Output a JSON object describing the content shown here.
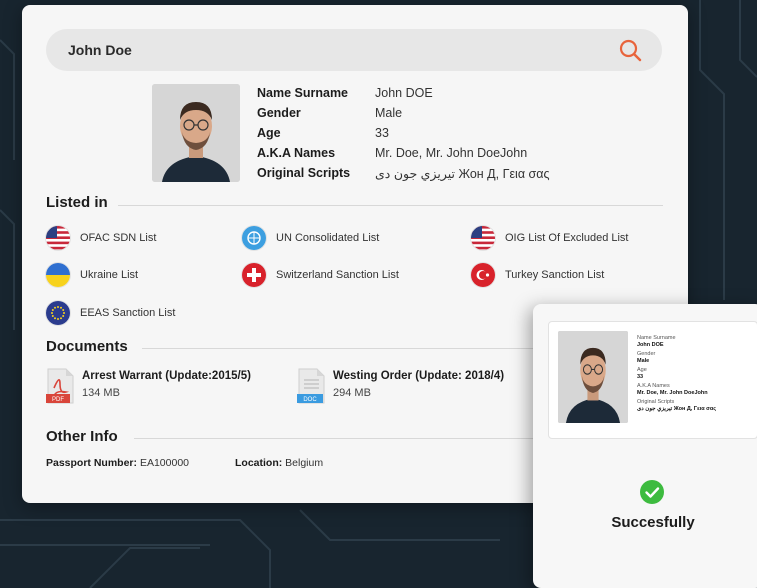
{
  "search": {
    "value": "John Doe",
    "icon": "search-icon"
  },
  "profile": {
    "fields": [
      {
        "label": "Name Surname",
        "value": "John DOE"
      },
      {
        "label": "Gender",
        "value": "Male"
      },
      {
        "label": "Age",
        "value": "33"
      },
      {
        "label": "A.K.A Names",
        "value": "Mr. Doe, Mr. John DoeJohn"
      },
      {
        "label": "Original Scripts",
        "value": "تيريزي جون دی Жон Д, Γεια σας"
      }
    ]
  },
  "listed_in": {
    "title": "Listed in",
    "items": [
      {
        "label": "OFAC SDN List",
        "icon": "usa-flag-icon"
      },
      {
        "label": "UN Consolidated List",
        "icon": "un-flag-icon"
      },
      {
        "label": "OIG List Of Excluded List",
        "icon": "usa-flag-icon"
      },
      {
        "label": "Ukraine List",
        "icon": "ukraine-flag-icon"
      },
      {
        "label": "Switzerland Sanction List",
        "icon": "switzerland-flag-icon"
      },
      {
        "label": "Turkey Sanction List",
        "icon": "turkey-flag-icon"
      },
      {
        "label": "EEAS Sanction List",
        "icon": "eu-flag-icon"
      }
    ]
  },
  "documents": {
    "title": "Documents",
    "items": [
      {
        "title": "Arrest Warrant (Update:2015/5)",
        "size": "134 MB",
        "type": "PDF"
      },
      {
        "title": "Westing Order (Update: 2018/4)",
        "size": "294 MB",
        "type": "DOC"
      }
    ]
  },
  "other_info": {
    "title": "Other Info",
    "passport_label": "Passport Number:",
    "passport_value": "EA100000",
    "location_label": "Location:",
    "location_value": "Belgium"
  },
  "result_card": {
    "fields": [
      {
        "label": "Name Surname",
        "value": "John DOE"
      },
      {
        "label": "Gender",
        "value": "Male"
      },
      {
        "label": "Age",
        "value": "33"
      },
      {
        "label": "A.K.A Names",
        "value": "Mr. Doe, Mr. John DoeJohn"
      },
      {
        "label": "Original Scripts",
        "value": "تيريزي جون دی Жон Д, Γεια σας"
      }
    ],
    "status": "Succesfully",
    "status_icon": "check-circle-icon"
  },
  "colors": {
    "accent": "#e8643c",
    "success": "#3dbb3f",
    "background": "#18252f"
  }
}
